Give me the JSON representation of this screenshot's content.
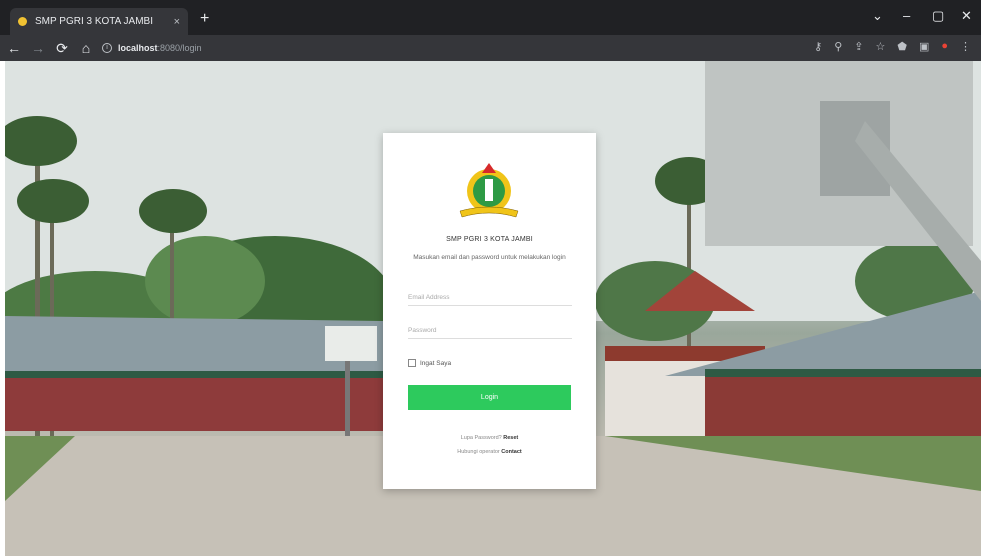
{
  "browser": {
    "tab_title": "SMP PGRI 3 KOTA JAMBI",
    "tab_close": "×",
    "new_tab": "+",
    "window_controls": [
      "⌄",
      "–",
      "▢",
      "✕"
    ],
    "nav": {
      "back": "←",
      "forward": "→",
      "reload": "⟳",
      "home": "⌂"
    },
    "url_host": "localhost",
    "url_path": ":8080/login",
    "toolbar_icons": [
      "⚷",
      "⚲",
      "⇪",
      "☆",
      "⬟",
      "▣",
      "●",
      "⋮"
    ]
  },
  "login": {
    "school_name": "SMP PGRI 3 KOTA JAMBI",
    "subtitle": "Masukan email dan password untuk melakukan login",
    "email_placeholder": "Email Address",
    "password_placeholder": "Password",
    "remember_label": "Ingat Saya",
    "login_button": "Login",
    "forgot_prefix": "Lupa Password? ",
    "forgot_link": "Reset",
    "contact_prefix": "Hubungi operator ",
    "contact_link": "Contact"
  },
  "colors": {
    "primary": "#2dca5d",
    "chrome_dark": "#202124",
    "chrome_toolbar": "#35363a"
  }
}
